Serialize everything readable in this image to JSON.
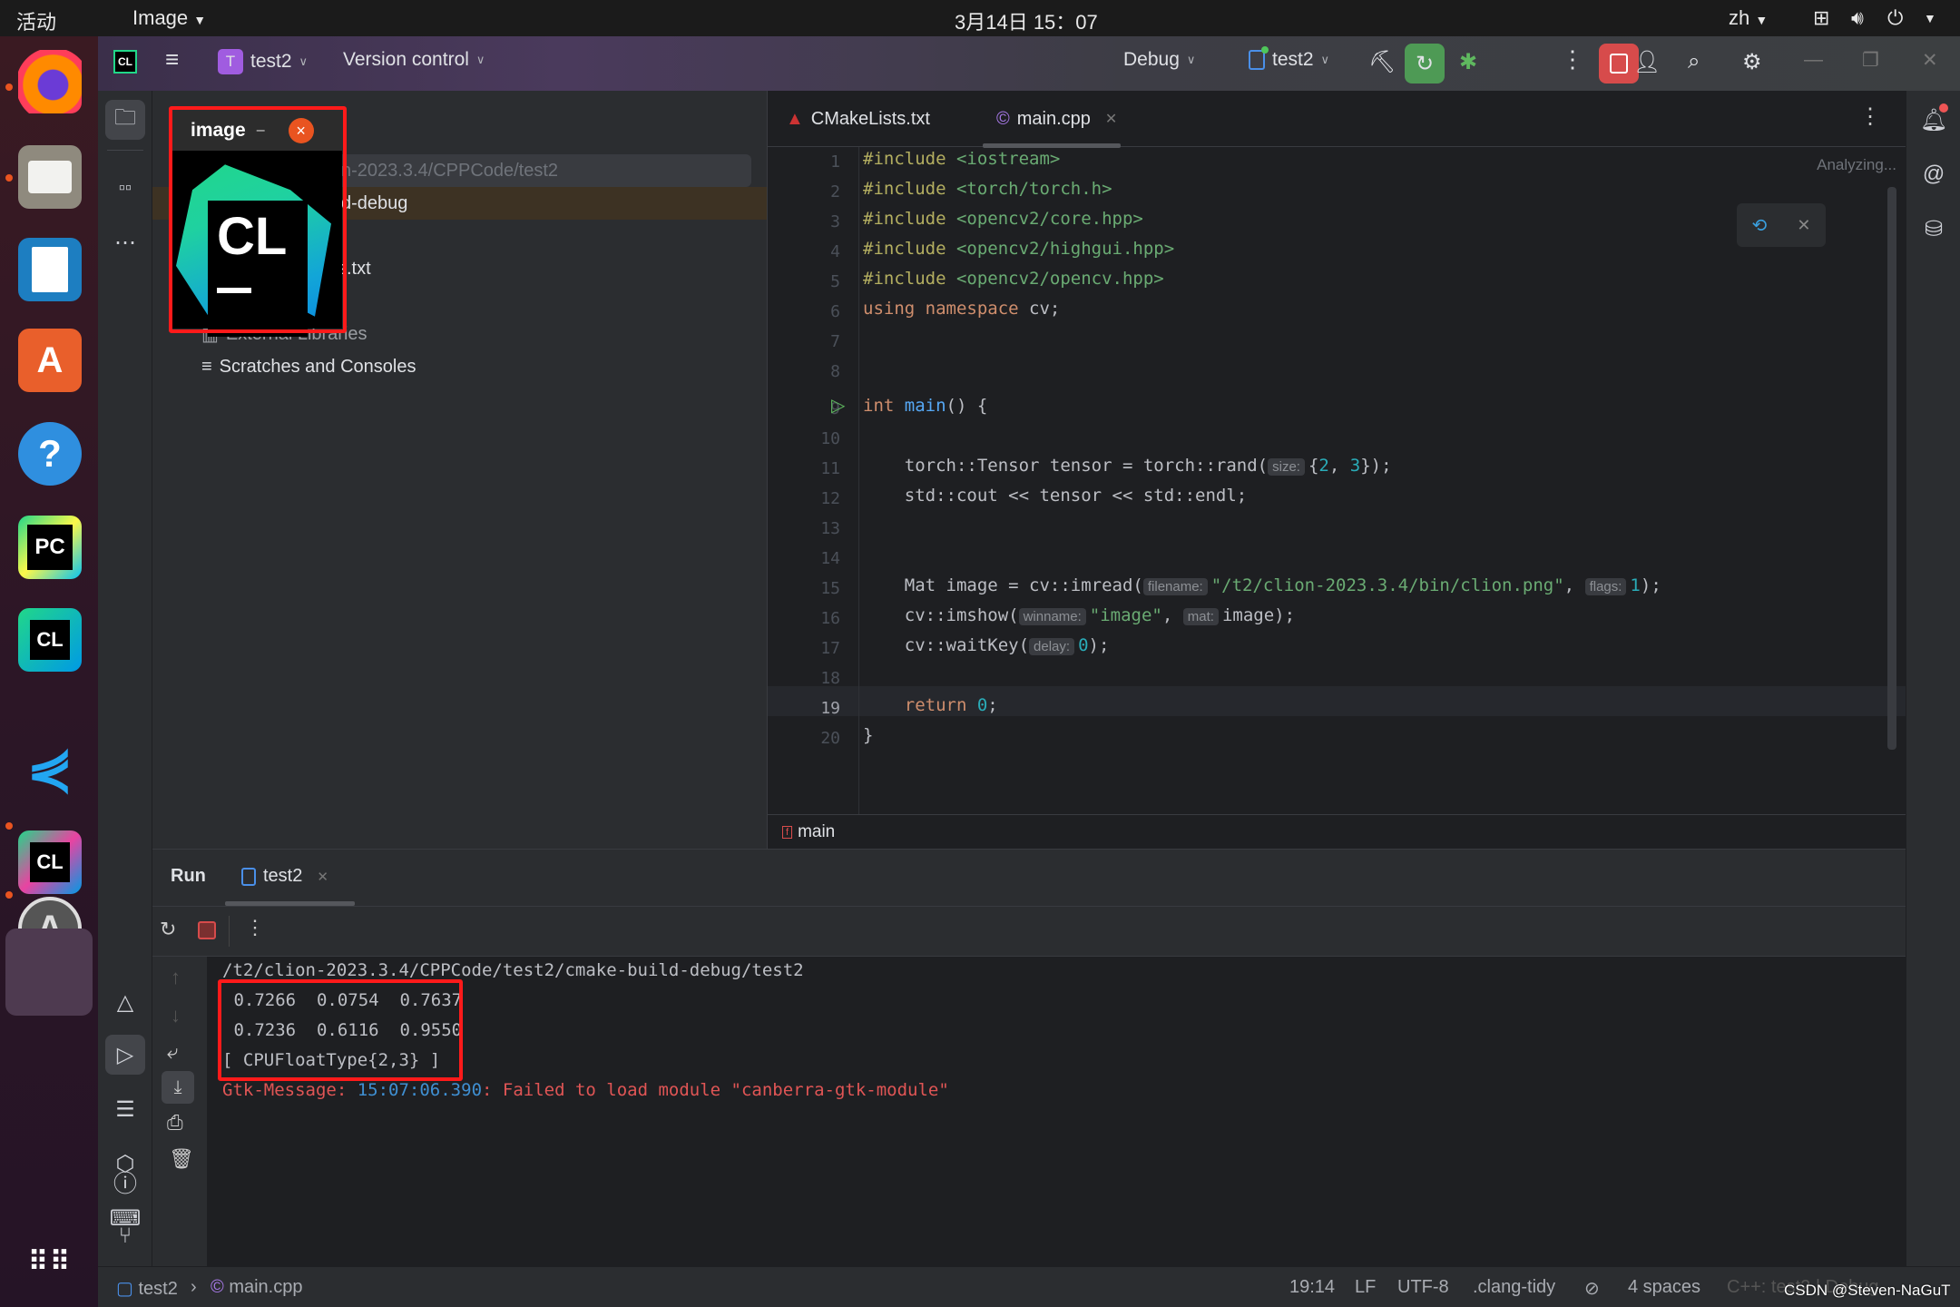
{
  "topbar": {
    "activities": "活动",
    "app_menu": "Image",
    "clock": "3月14日 15：07",
    "lang": "zh"
  },
  "dock": {
    "items": [
      {
        "name": "firefox",
        "label": "Firefox",
        "running": true
      },
      {
        "name": "files",
        "label": "Files",
        "running": true
      },
      {
        "name": "writer",
        "label": "LibreOffice Writer",
        "running": false
      },
      {
        "name": "software",
        "label": "A",
        "running": false
      },
      {
        "name": "help",
        "label": "?",
        "running": false
      },
      {
        "name": "pycharm",
        "label": "PC",
        "running": false
      },
      {
        "name": "clion",
        "label": "CL",
        "running": false
      },
      {
        "name": "vscode",
        "label": "VS Code",
        "running": false
      },
      {
        "name": "clion-running",
        "label": "CL",
        "running": true
      },
      {
        "name": "software-updater",
        "label": "A",
        "running": true
      },
      {
        "name": "image-window",
        "label": "",
        "running": true
      }
    ],
    "show_apps": "Show Applications"
  },
  "ide": {
    "logo": "CL",
    "project_badge": "T",
    "project_name": "test2",
    "vcs": "Version control",
    "config": "Debug",
    "run_target": "test2"
  },
  "project_tree": {
    "root_path": "n-2023.3.4/CPPCode/test2",
    "items": [
      "d-debug",
      "s.txt",
      "External Libraries",
      "Scratches and Consoles"
    ]
  },
  "image_window": {
    "title": "image",
    "minimize": "–",
    "close": "×",
    "content": "CL"
  },
  "editor": {
    "tabs": [
      {
        "label": "CMakeLists.txt",
        "active": false
      },
      {
        "label": "main.cpp",
        "active": true
      }
    ],
    "status": "Analyzing...",
    "breadcrumb": "main",
    "current_line": 19,
    "lines": [
      {
        "n": "1",
        "segs": [
          [
            "pp",
            "#include "
          ],
          [
            "str",
            "<iostream>"
          ]
        ]
      },
      {
        "n": "2",
        "segs": [
          [
            "pp",
            "#include "
          ],
          [
            "str",
            "<torch/torch.h>"
          ]
        ]
      },
      {
        "n": "3",
        "segs": [
          [
            "pp",
            "#include "
          ],
          [
            "str",
            "<opencv2/core.hpp>"
          ]
        ]
      },
      {
        "n": "4",
        "segs": [
          [
            "pp",
            "#include "
          ],
          [
            "str",
            "<opencv2/highgui.hpp>"
          ]
        ]
      },
      {
        "n": "5",
        "segs": [
          [
            "pp",
            "#include "
          ],
          [
            "str",
            "<opencv2/opencv.hpp>"
          ]
        ]
      },
      {
        "n": "6",
        "segs": [
          [
            "kw",
            "using namespace "
          ],
          [
            "ns",
            "cv;"
          ]
        ]
      },
      {
        "n": "7",
        "segs": []
      },
      {
        "n": "8",
        "segs": []
      },
      {
        "n": "9",
        "segs": [
          [
            "kw",
            "int "
          ],
          [
            "fn",
            "main"
          ],
          [
            "ns",
            "() {"
          ]
        ]
      },
      {
        "n": "10",
        "segs": []
      },
      {
        "n": "11",
        "segs": [
          [
            "ns",
            "    torch::Tensor tensor = torch::rand("
          ],
          [
            "hint",
            "size:"
          ],
          [
            "ns",
            "{"
          ],
          [
            "num",
            "2"
          ],
          [
            "ns",
            ", "
          ],
          [
            "num",
            "3"
          ],
          [
            "ns",
            "});"
          ]
        ]
      },
      {
        "n": "12",
        "segs": [
          [
            "ns",
            "    std::cout << tensor << std::endl;"
          ]
        ]
      },
      {
        "n": "13",
        "segs": []
      },
      {
        "n": "14",
        "segs": []
      },
      {
        "n": "15",
        "segs": [
          [
            "ns",
            "    Mat image = cv::imread("
          ],
          [
            "hint",
            "filename:"
          ],
          [
            "str",
            "\"/t2/clion-2023.3.4/bin/clion.png\""
          ],
          [
            "ns",
            ", "
          ],
          [
            "hint",
            "flags:"
          ],
          [
            "num",
            "1"
          ],
          [
            "ns",
            ");"
          ]
        ]
      },
      {
        "n": "16",
        "segs": [
          [
            "ns",
            "    cv::imshow("
          ],
          [
            "hint",
            "winname:"
          ],
          [
            "str",
            "\"image\""
          ],
          [
            "ns",
            ", "
          ],
          [
            "hint",
            "mat:"
          ],
          [
            "ns",
            "image);"
          ]
        ]
      },
      {
        "n": "17",
        "segs": [
          [
            "ns",
            "    cv::waitKey("
          ],
          [
            "hint",
            "delay:"
          ],
          [
            "num",
            "0"
          ],
          [
            "ns",
            ");"
          ]
        ]
      },
      {
        "n": "18",
        "segs": []
      },
      {
        "n": "19",
        "segs": [
          [
            "kw",
            "    return "
          ],
          [
            "num",
            "0"
          ],
          [
            "ns",
            ";"
          ]
        ]
      },
      {
        "n": "20",
        "segs": [
          [
            "ns",
            "}"
          ]
        ]
      }
    ]
  },
  "run": {
    "title": "Run",
    "tab": "test2",
    "output": {
      "path": "/t2/clion-2023.3.4/CPPCode/test2/cmake-build-debug/test2",
      "tensor_rows": [
        " 0.7266  0.0754  0.7637",
        " 0.7236  0.6116  0.9550"
      ],
      "tensor_type": "[ CPUFloatType{2,3} ]",
      "gtk_prefix": "Gtk-Message",
      "gtk_time": "15:07:06.390",
      "gtk_msg": ": Failed to load module \"canberra-gtk-module\""
    }
  },
  "statusbar": {
    "project": "test2",
    "file": "main.cpp",
    "position": "19:14",
    "line_sep": "LF",
    "encoding": "UTF-8",
    "linter": ".clang-tidy",
    "indent": "4 spaces",
    "context": "C++: test2 | Debug",
    "watermark": "CSDN @Steven-NaGuT"
  }
}
